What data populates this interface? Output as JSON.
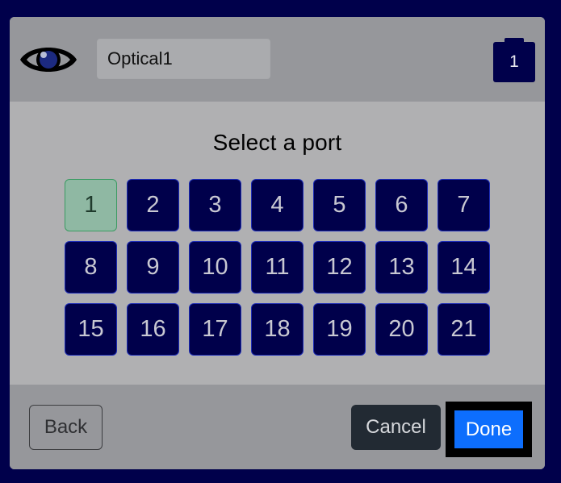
{
  "header": {
    "name_value": "Optical1",
    "battery_label": "1",
    "eye_icon": "eye-icon",
    "battery_icon": "battery-icon"
  },
  "title": "Select a port",
  "ports": [
    "1",
    "2",
    "3",
    "4",
    "5",
    "6",
    "7",
    "8",
    "9",
    "10",
    "11",
    "12",
    "13",
    "14",
    "15",
    "16",
    "17",
    "18",
    "19",
    "20",
    "21"
  ],
  "selected_port": "1",
  "footer": {
    "back_label": "Back",
    "cancel_label": "Cancel",
    "done_label": "Done"
  },
  "colors": {
    "background": "#00004b",
    "port": "#00004b",
    "selected_port": "#8fb8a3",
    "primary": "#0d6efd"
  }
}
